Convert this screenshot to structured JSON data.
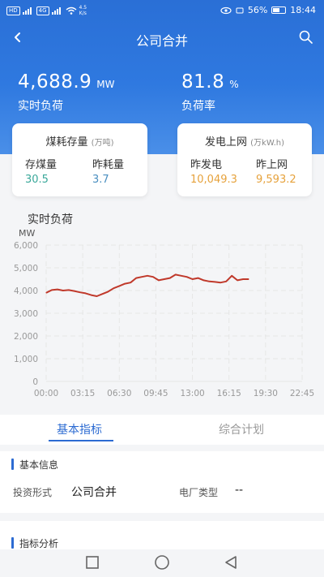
{
  "status_bar": {
    "left_chips": [
      "HD",
      "4G"
    ],
    "speed_value": "4.5",
    "speed_unit": "K/s",
    "battery": "56%",
    "time": "18:44"
  },
  "header": {
    "title": "公司合并"
  },
  "kpis": [
    {
      "value": "4,688.9",
      "unit": "MW",
      "label": "实时负荷"
    },
    {
      "value": "81.8",
      "unit": "%",
      "label": "负荷率"
    }
  ],
  "coal_card": {
    "title": "煤耗存量",
    "unit": "(万吨)",
    "items": [
      {
        "label": "存煤量",
        "value": "30.5"
      },
      {
        "label": "昨耗量",
        "value": "3.7"
      }
    ]
  },
  "power_card": {
    "title": "发电上网",
    "unit": "(万kW.h)",
    "items": [
      {
        "label": "昨发电",
        "value": "10,049.3"
      },
      {
        "label": "昨上网",
        "value": "9,593.2"
      }
    ]
  },
  "chart_title": "实时负荷",
  "colors": {
    "brand": "#2c6bd2",
    "coal_value": "#3aa89a",
    "coal_value2": "#4a8fc0",
    "power_value": "#e6a23c",
    "line": "#c0392b"
  },
  "chart_data": {
    "type": "line",
    "title": "实时负荷",
    "ylabel": "MW",
    "ylim": [
      0,
      6000
    ],
    "yticks": [
      "0",
      "1,000",
      "2,000",
      "3,000",
      "4,000",
      "5,000",
      "6,000"
    ],
    "xticks": [
      "00:00",
      "03:15",
      "06:30",
      "09:45",
      "13:00",
      "16:15",
      "19:30",
      "22:45"
    ],
    "grid": true,
    "series": [
      {
        "x_hours": [
          0,
          0.5,
          1,
          1.5,
          2,
          2.5,
          3,
          3.5,
          4,
          4.5,
          5,
          5.5,
          6,
          6.5,
          7,
          7.5,
          8,
          8.5,
          9,
          9.5,
          10,
          10.5,
          11,
          11.5,
          12,
          12.5,
          13,
          13.5,
          14,
          14.5,
          15,
          15.5,
          16,
          16.5,
          17,
          17.5,
          18
        ],
        "values": [
          3900,
          4020,
          4050,
          4000,
          4020,
          3980,
          3920,
          3880,
          3800,
          3750,
          3850,
          3950,
          4100,
          4200,
          4300,
          4350,
          4550,
          4600,
          4650,
          4600,
          4450,
          4500,
          4550,
          4700,
          4650,
          4600,
          4500,
          4550,
          4450,
          4400,
          4380,
          4350,
          4400,
          4650,
          4450,
          4500,
          4500
        ]
      }
    ]
  },
  "tabs": [
    {
      "label": "基本指标",
      "active": true
    },
    {
      "label": "综合计划",
      "active": false
    }
  ],
  "basic_info": {
    "heading": "基本信息",
    "fields": [
      {
        "label": "投资形式",
        "value": "公司合并"
      },
      {
        "label": "电厂类型",
        "value": "--"
      }
    ]
  },
  "analysis": {
    "heading": "指标分析"
  }
}
